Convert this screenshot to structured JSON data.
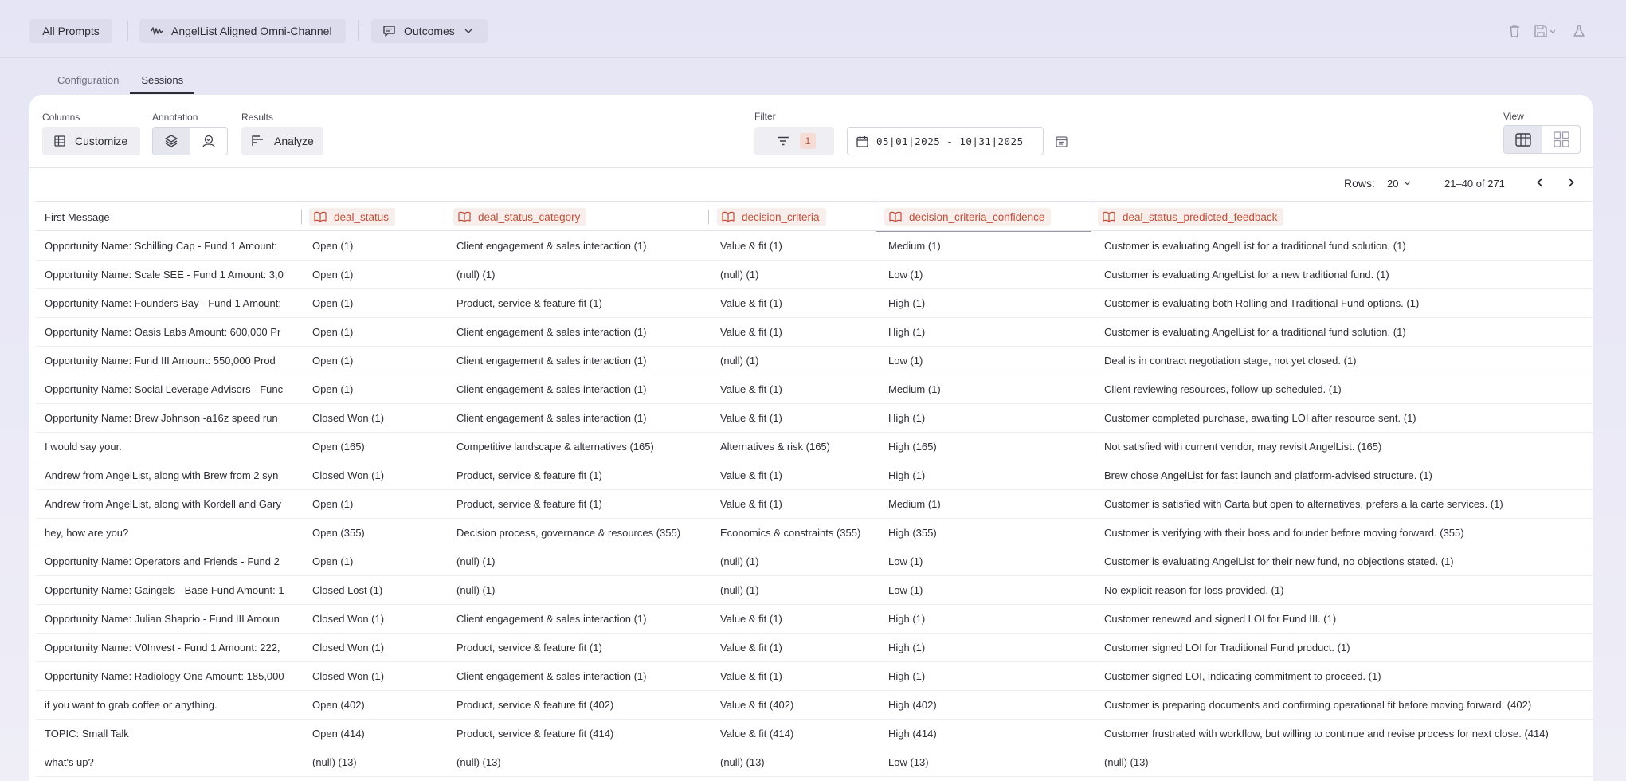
{
  "topbar": {
    "all_prompts": "All Prompts",
    "prompt_name": "AngelList Aligned Omni-Channel",
    "outcomes": "Outcomes"
  },
  "tabs": [
    {
      "label": "Configuration",
      "active": false
    },
    {
      "label": "Sessions",
      "active": true
    }
  ],
  "toolbar": {
    "columns_label": "Columns",
    "customize_label": "Customize",
    "annotation_label": "Annotation",
    "results_label": "Results",
    "analyze_label": "Analyze",
    "filter_label": "Filter",
    "filter_count": "1",
    "date_range": "05|01|2025 - 10|31|2025",
    "view_label": "View"
  },
  "pagination": {
    "rows_label": "Rows:",
    "rows_value": "20",
    "range": "21–40 of 271"
  },
  "table": {
    "columns": [
      "First Message",
      "deal_status",
      "deal_status_category",
      "decision_criteria",
      "decision_criteria_confidence",
      "deal_status_predicted_feedback"
    ],
    "rows": [
      [
        "Opportunity Name: Schilling Cap - Fund 1 Amount:",
        "Open (1)",
        "Client engagement & sales interaction (1)",
        "Value & fit (1)",
        "Medium (1)",
        "Customer is evaluating AngelList for a traditional fund solution. (1)"
      ],
      [
        "Opportunity Name: Scale SEE - Fund 1 Amount: 3,0",
        "Open (1)",
        "(null) (1)",
        "(null) (1)",
        "Low (1)",
        "Customer is evaluating AngelList for a new traditional fund. (1)"
      ],
      [
        "Opportunity Name: Founders Bay - Fund 1 Amount:",
        "Open (1)",
        "Product, service & feature fit (1)",
        "Value & fit (1)",
        "High (1)",
        "Customer is evaluating both Rolling and Traditional Fund options. (1)"
      ],
      [
        "Opportunity Name: Oasis Labs Amount: 600,000 Pr",
        "Open (1)",
        "Client engagement & sales interaction (1)",
        "Value & fit (1)",
        "High (1)",
        "Customer is evaluating AngelList for a traditional fund solution. (1)"
      ],
      [
        "Opportunity Name: Fund III Amount: 550,000 Prod",
        "Open (1)",
        "Client engagement & sales interaction (1)",
        "(null) (1)",
        "Low (1)",
        "Deal is in contract negotiation stage, not yet closed. (1)"
      ],
      [
        "Opportunity Name: Social Leverage Advisors - Func",
        "Open (1)",
        "Client engagement & sales interaction (1)",
        "Value & fit (1)",
        "Medium (1)",
        "Client reviewing resources, follow-up scheduled. (1)"
      ],
      [
        "Opportunity Name: Brew Johnson -a16z speed run",
        "Closed Won (1)",
        "Client engagement & sales interaction (1)",
        "Value & fit (1)",
        "High (1)",
        "Customer completed purchase, awaiting LOI after resource sent. (1)"
      ],
      [
        "I would say your.",
        "Open (165)",
        "Competitive landscape & alternatives (165)",
        "Alternatives & risk (165)",
        "High (165)",
        "Not satisfied with current vendor, may revisit AngelList. (165)"
      ],
      [
        "Andrew from AngelList, along with Brew from 2 syn",
        "Closed Won (1)",
        "Product, service & feature fit (1)",
        "Value & fit (1)",
        "High (1)",
        "Brew chose AngelList for fast launch and platform-advised structure. (1)"
      ],
      [
        "Andrew from AngelList, along with Kordell and Gary",
        "Open (1)",
        "Product, service & feature fit (1)",
        "Value & fit (1)",
        "Medium (1)",
        "Customer is satisfied with Carta but open to alternatives, prefers a la carte services. (1)"
      ],
      [
        "hey, how are you?",
        "Open (355)",
        "Decision process, governance & resources (355)",
        "Economics & constraints (355)",
        "High (355)",
        "Customer is verifying with their boss and founder before moving forward. (355)"
      ],
      [
        "Opportunity Name: Operators and Friends - Fund 2",
        "Open (1)",
        "(null) (1)",
        "(null) (1)",
        "Low (1)",
        "Customer is evaluating AngelList for their new fund, no objections stated. (1)"
      ],
      [
        "Opportunity Name: Gaingels - Base Fund Amount: 1",
        "Closed Lost (1)",
        "(null) (1)",
        "(null) (1)",
        "Low (1)",
        "No explicit reason for loss provided. (1)"
      ],
      [
        "Opportunity Name: Julian Shaprio - Fund III Amoun",
        "Closed Won (1)",
        "Client engagement & sales interaction (1)",
        "Value & fit (1)",
        "High (1)",
        "Customer renewed and signed LOI for Fund III. (1)"
      ],
      [
        "Opportunity Name: V0Invest - Fund 1 Amount: 222,",
        "Closed Won (1)",
        "Product, service & feature fit (1)",
        "Value & fit (1)",
        "High (1)",
        "Customer signed LOI for Traditional Fund product. (1)"
      ],
      [
        "Opportunity Name: Radiology One Amount: 185,000",
        "Closed Won (1)",
        "Client engagement & sales interaction (1)",
        "Value & fit (1)",
        "High (1)",
        "Customer signed LOI, indicating commitment to proceed. (1)"
      ],
      [
        "if you want to grab coffee or anything.",
        "Open (402)",
        "Product, service & feature fit (402)",
        "Value & fit (402)",
        "High (402)",
        "Customer is preparing documents and confirming operational fit before moving forward. (402)"
      ],
      [
        "TOPIC: Small Talk",
        "Open (414)",
        "Product, service & feature fit (414)",
        "Value & fit (414)",
        "High (414)",
        "Customer frustrated with workflow, but willing to continue and revise process for next close. (414)"
      ],
      [
        "what's up?",
        "(null) (13)",
        "(null) (13)",
        "(null) (13)",
        "Low (13)",
        "(null) (13)"
      ]
    ]
  }
}
